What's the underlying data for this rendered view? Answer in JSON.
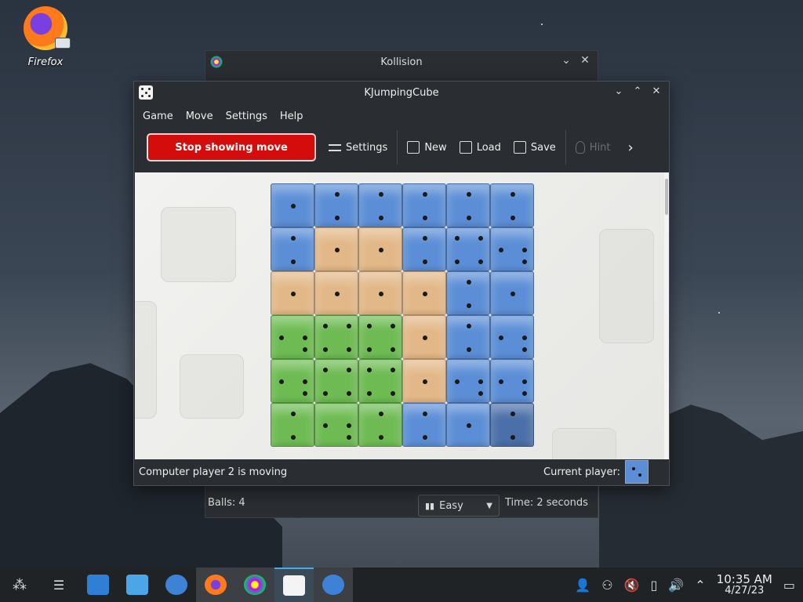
{
  "desktop": {
    "icon_label": "Firefox"
  },
  "back_window": {
    "title": "Kollision",
    "status_balls": "Balls: 4",
    "difficulty": "Easy",
    "time": "Time: 2 seconds"
  },
  "main_window": {
    "title": "KJumpingCube",
    "menu": [
      "Game",
      "Move",
      "Settings",
      "Help"
    ],
    "toolbar": {
      "stop_label": "Stop showing move",
      "settings_label": "Settings",
      "new_label": "New",
      "load_label": "Load",
      "save_label": "Save",
      "hint_label": "Hint"
    },
    "board": [
      [
        [
          "blue",
          1
        ],
        [
          "blue",
          2
        ],
        [
          "blue",
          2
        ],
        [
          "blue",
          2
        ],
        [
          "blue",
          2
        ],
        [
          "blue",
          2
        ]
      ],
      [
        [
          "blue",
          2
        ],
        [
          "orange",
          1
        ],
        [
          "orange",
          1
        ],
        [
          "blue",
          2
        ],
        [
          "blue",
          4
        ],
        [
          "blue",
          3
        ]
      ],
      [
        [
          "orange",
          1
        ],
        [
          "orange",
          1
        ],
        [
          "orange",
          1
        ],
        [
          "orange",
          1
        ],
        [
          "blue",
          2
        ],
        [
          "blue",
          1
        ]
      ],
      [
        [
          "green",
          3
        ],
        [
          "green",
          4
        ],
        [
          "green",
          4
        ],
        [
          "orange",
          1
        ],
        [
          "blue",
          2
        ],
        [
          "blue",
          3
        ]
      ],
      [
        [
          "green",
          3
        ],
        [
          "green",
          4
        ],
        [
          "green",
          4
        ],
        [
          "orange",
          1
        ],
        [
          "blue",
          3
        ],
        [
          "blue",
          3
        ]
      ],
      [
        [
          "green",
          2
        ],
        [
          "green",
          3
        ],
        [
          "green",
          2
        ],
        [
          "blue",
          2
        ],
        [
          "blue",
          1
        ],
        [
          "dark",
          2
        ]
      ]
    ],
    "status_text": "Computer player 2 is moving",
    "current_player_label": "Current player:"
  },
  "taskbar": {
    "time": "10:35 AM",
    "date": "4/27/23"
  },
  "colors": {
    "blue": "#5b8ed6",
    "orange": "#e3b888",
    "green": "#6dbb52",
    "stop_button": "#d40c0c"
  }
}
